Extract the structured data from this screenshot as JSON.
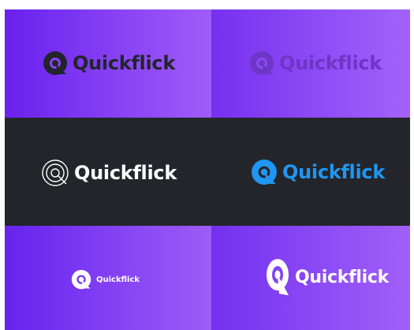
{
  "brand": {
    "name": "Quickflick"
  },
  "variants": [
    {
      "background": "purple-gradient",
      "color": "#22252b",
      "icon": "quickflick-q-solid-icon"
    },
    {
      "background": "purple-gradient",
      "color": "#6e36c7",
      "icon": "quickflick-q-solid-icon"
    },
    {
      "background": "#23252a",
      "color": "#ffffff",
      "icon": "quickflick-q-outline-icon"
    },
    {
      "background": "#23252a",
      "color": "#1f96f2",
      "icon": "quickflick-q-solid-icon"
    },
    {
      "background": "purple-gradient",
      "color": "#ffffff",
      "icon": "quickflick-q-solid-icon"
    },
    {
      "background": "purple-gradient",
      "color": "#ffffff",
      "icon": "quickflick-q-tall-icon"
    }
  ]
}
